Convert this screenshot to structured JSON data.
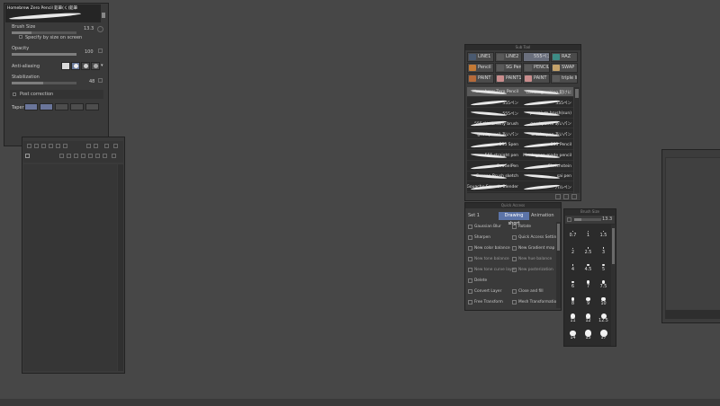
{
  "tool_property": {
    "brush_name": "Homebrew Zero Pencil 鉛筆(く)鉛筆",
    "brush_size_label": "Brush Size",
    "brush_size_value": "13.3",
    "specify_label": "Specify by size on screen",
    "opacity_label": "Opacity",
    "opacity_value": "100",
    "opacity_fraction": 1.0,
    "antialias_label": "Anti-aliasing",
    "stabilization_label": "Stabilization",
    "stabilization_value": "48",
    "stabilization_fraction": 0.48,
    "post_correction_label": "Post correction",
    "taper_label": "Taper"
  },
  "sub_tool": {
    "title": "Sub Tool",
    "tools": [
      {
        "label": "LINE1",
        "color": "#4a5a70"
      },
      {
        "label": "LINE2",
        "color": "#5a5a5a"
      },
      {
        "label": "555ペン",
        "color": "#6a6f7d"
      },
      {
        "label": "RAZ",
        "color": "#3d8c85"
      },
      {
        "label": "Pencil",
        "color": "#c47a35"
      },
      {
        "label": "SG Pen",
        "color": "#5a5a5a"
      },
      {
        "label": "PENCIL",
        "color": "#5a5a5a"
      },
      {
        "label": "SWAP",
        "color": "#c4a26a"
      },
      {
        "label": "PAINT",
        "color": "#b56a3a"
      },
      {
        "label": "PAINT1",
        "color": "#c98c8c"
      },
      {
        "label": "PAINT",
        "color": "#c98c8c"
      },
      {
        "label": "triple li",
        "color": "#5a5a5a"
      }
    ],
    "brushes": [
      [
        "Homebrew Zero Pencil",
        "custom_making 鉛けに"
      ],
      [
        "555ペン",
        "555ペン"
      ],
      [
        "555ペン",
        "premium brush(sun)"
      ],
      [
        "555ペン Brushy brush",
        "good pencil あいパン"
      ],
      [
        "good pencil あいパン",
        "brush+pen あいパン"
      ],
      [
        "555 Spen",
        "555 Pencil"
      ],
      [
        "555 straight pen",
        "Manta_pen made pencil"
      ],
      [
        "SeaGelPen",
        "Sketchstein"
      ],
      [
        "Season Brush sketch",
        "sai pen"
      ],
      [
        "Gouache Smooth Blender",
        "パルペン"
      ]
    ]
  },
  "command_bar": {
    "title": "Quick Access",
    "tabs": [
      "Set 1",
      "Drawing short",
      "Animation"
    ],
    "commands": [
      [
        "Gaussian Blur",
        "Rotate"
      ],
      [
        "Sharpen",
        "Quick Access Settings"
      ],
      [
        "New color balance",
        "New Gradient map"
      ],
      [
        "New tone balance",
        "New hue balance"
      ],
      [
        "New tone curve layer",
        "New posterization"
      ],
      [
        "Delete",
        ""
      ],
      [
        "Convert Layer",
        "Close and fill"
      ],
      [
        "Free Transform",
        "Mesh Transformation"
      ]
    ]
  },
  "brush_size": {
    "title": "Brush Size",
    "value": "13.3",
    "sizes": [
      "0.7",
      "1",
      "1.5",
      "2",
      "2.5",
      "3",
      "4",
      "4.5",
      "5",
      "6",
      "7",
      "7.5",
      "8",
      "9",
      "10",
      "11",
      "12",
      "12.5",
      "14",
      "15",
      "17"
    ]
  }
}
